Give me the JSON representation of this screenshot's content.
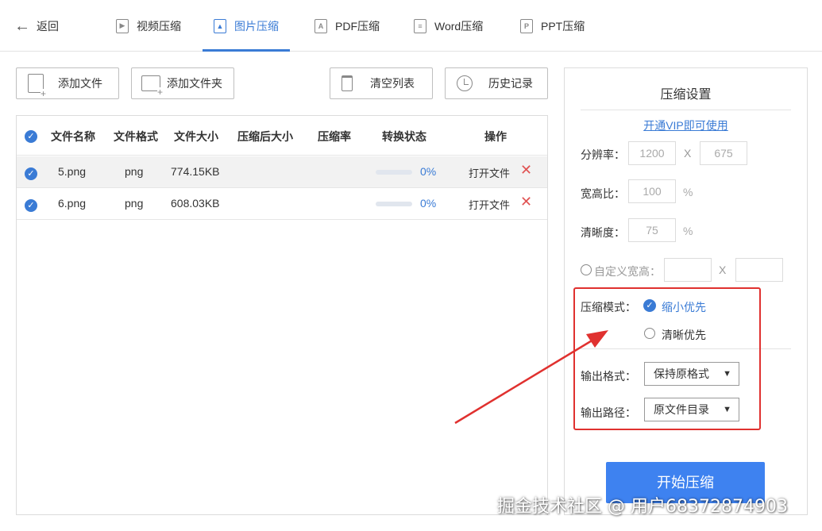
{
  "nav": {
    "back_label": "返回",
    "tabs": [
      {
        "label": "视频压缩",
        "icon": "play-icon"
      },
      {
        "label": "图片压缩",
        "icon": "image-icon",
        "active": true
      },
      {
        "label": "PDF压缩",
        "icon": "pdf-icon"
      },
      {
        "label": "Word压缩",
        "icon": "document-icon"
      },
      {
        "label": "PPT压缩",
        "icon": "ppt-icon"
      }
    ]
  },
  "toolbar": {
    "add_file": "添加文件",
    "add_folder": "添加文件夹",
    "clear_list": "清空列表",
    "history": "历史记录"
  },
  "table": {
    "headers": [
      "文件名称",
      "文件格式",
      "文件大小",
      "压缩后大小",
      "压缩率",
      "转换状态",
      "操作"
    ],
    "rows": [
      {
        "name": "5.png",
        "format": "png",
        "size": "774.15KB",
        "compressed_size": "",
        "ratio": "",
        "progress": "0%",
        "open": "打开文件",
        "selected": true
      },
      {
        "name": "6.png",
        "format": "png",
        "size": "608.03KB",
        "compressed_size": "",
        "ratio": "",
        "progress": "0%",
        "open": "打开文件",
        "selected": false
      }
    ]
  },
  "settings": {
    "title": "压缩设置",
    "vip_link": "开通VIP即可使用",
    "resolution_label": "分辨率：",
    "resolution_w": "1200",
    "resolution_x": "X",
    "resolution_h": "675",
    "aspect_label": "宽高比：",
    "aspect_value": "100",
    "aspect_unit": "%",
    "clarity_label": "清晰度：",
    "clarity_value": "75",
    "clarity_unit": "%",
    "custom_label": "自定义宽高：",
    "custom_x": "X",
    "mode_label": "压缩模式：",
    "mode_small": "缩小优先",
    "mode_clear": "清晰优先",
    "format_label": "输出格式：",
    "format_value": "保持原格式",
    "path_label": "输出路径：",
    "path_value": "原文件目录",
    "start_button": "开始压缩"
  },
  "colors": {
    "accent": "#3a7bd5",
    "annotation": "#e0312f",
    "button": "#3e82f0"
  },
  "watermark": "掘金技术社区 @ 用户6837287490​3"
}
